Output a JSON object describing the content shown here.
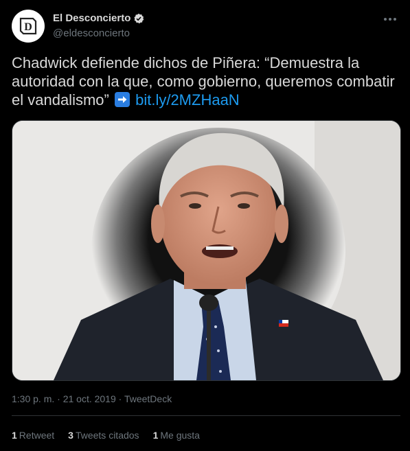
{
  "author": {
    "display_name": "El Desconcierto",
    "handle": "@eldesconcierto",
    "avatar_icon": "eldesconcierto-logo",
    "verified": true
  },
  "tweet": {
    "text": "Chadwick defiende dichos de Piñera: “Demuestra la autoridad con la que, como gobierno, queremos combatir el vandalismo”",
    "emoji": "right-arrow-emoji",
    "link": "bit.ly/2MZHaaN",
    "timestamp": "1:30 p. m. · 21 oct. 2019 · TweetDeck"
  },
  "stats": {
    "retweets_count": "1",
    "retweets_label": "Retweet",
    "quotes_count": "3",
    "quotes_label": "Tweets citados",
    "likes_count": "1",
    "likes_label": "Me gusta"
  },
  "colors": {
    "background": "#000000",
    "text": "#d9d9d9",
    "secondary": "#6e767d",
    "link": "#1d9bf0"
  }
}
